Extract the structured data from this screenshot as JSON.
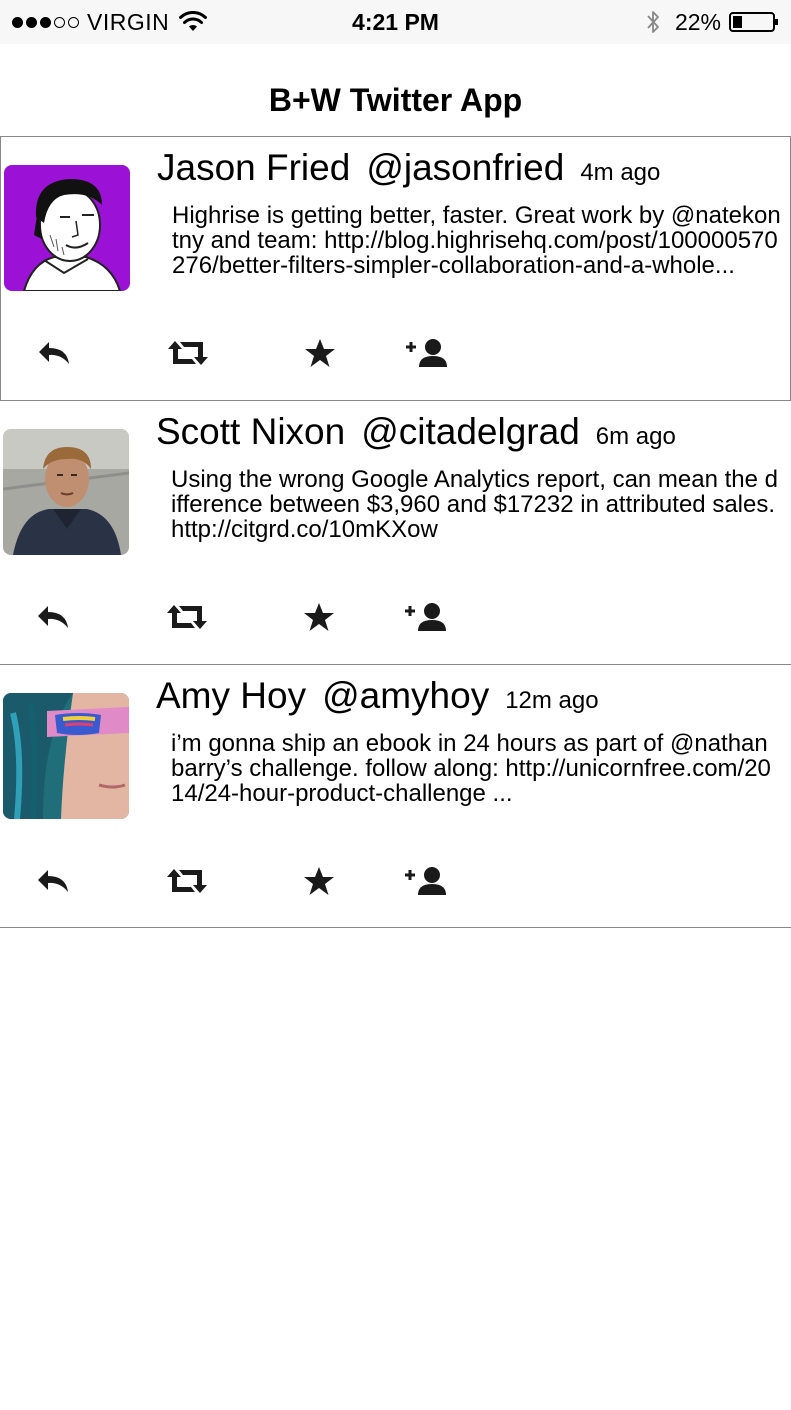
{
  "status_bar": {
    "carrier": "VIRGIN",
    "signal_bars_filled": 3,
    "signal_bars_total": 5,
    "time": "4:21 PM",
    "battery_percent": "22%",
    "icons": [
      "wifi-icon",
      "bluetooth-icon",
      "battery-icon"
    ]
  },
  "header": {
    "title": "B+W Twitter App"
  },
  "tweets": [
    {
      "name": "Jason Fried",
      "handle": "@jasonfried",
      "time": "4m ago",
      "text": "Highrise is getting better, faster. Great work by @natekontny and team: http://blog.highrisehq.com/post/100000570276/better-filters-simpler-collaboration-and-a-whole...",
      "avatar_bg": "#9b12d6"
    },
    {
      "name": "Scott Nixon",
      "handle": "@citadelgrad",
      "time": "6m ago",
      "text": "Using the wrong Google Analytics report, can mean the difference between $3,960 and $17232 in attributed sales. http://citgrd.co/10mKXow",
      "avatar_bg": "#9a9a96"
    },
    {
      "name": "Amy Hoy",
      "handle": "@amyhoy",
      "time": "12m ago",
      "text": "i’m gonna ship an ebook in 24 hours as part of @nathanbarry’s challenge. follow along: http://unicornfree.com/2014/24-hour-product-challenge ...",
      "avatar_bg": "#1f6e7a"
    }
  ],
  "actions": [
    "reply-icon",
    "retweet-icon",
    "favorite-icon",
    "follow-icon"
  ],
  "colors": {
    "text": "#000000",
    "divider": "#888888",
    "status_bar_bg": "#f7f7f7",
    "icon": "#1a1a1a"
  }
}
